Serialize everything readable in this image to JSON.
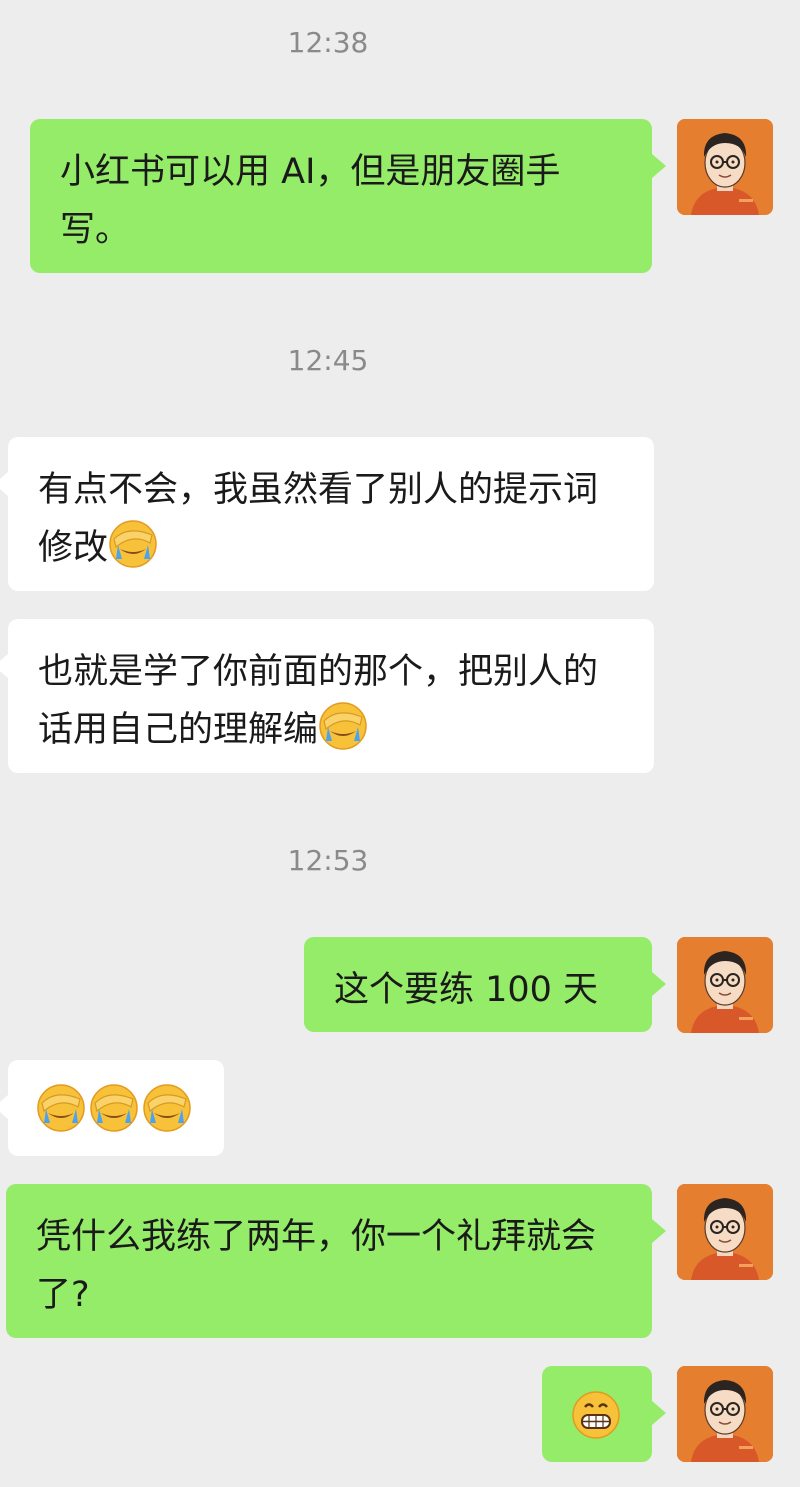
{
  "timestamps": [
    "12:38",
    "12:45",
    "12:53"
  ],
  "messages": [
    {
      "side": "me",
      "text": "小红书可以用 AI，但是朋友圈手写。"
    },
    {
      "side": "them",
      "text": "有点不会，我虽然看了别人的提示词修改",
      "emoji": "facepalm-crying"
    },
    {
      "side": "them",
      "text": "也就是学了你前面的那个，把别人的话用自己的理解编",
      "emoji": "facepalm-crying"
    },
    {
      "side": "me",
      "text": "这个要练 100 天"
    },
    {
      "side": "them",
      "emojis": [
        "facepalm-crying",
        "facepalm-crying",
        "facepalm-crying"
      ]
    },
    {
      "side": "me",
      "text": "凭什么我练了两年，你一个礼拜就会了?"
    },
    {
      "side": "me",
      "emoji": "grinning-smile"
    }
  ],
  "colors": {
    "background": "#ededed",
    "my_bubble": "#95ec69",
    "their_bubble": "#ffffff",
    "timestamp_text": "#8a8a8a",
    "avatar_bg": "#e57e2f"
  }
}
